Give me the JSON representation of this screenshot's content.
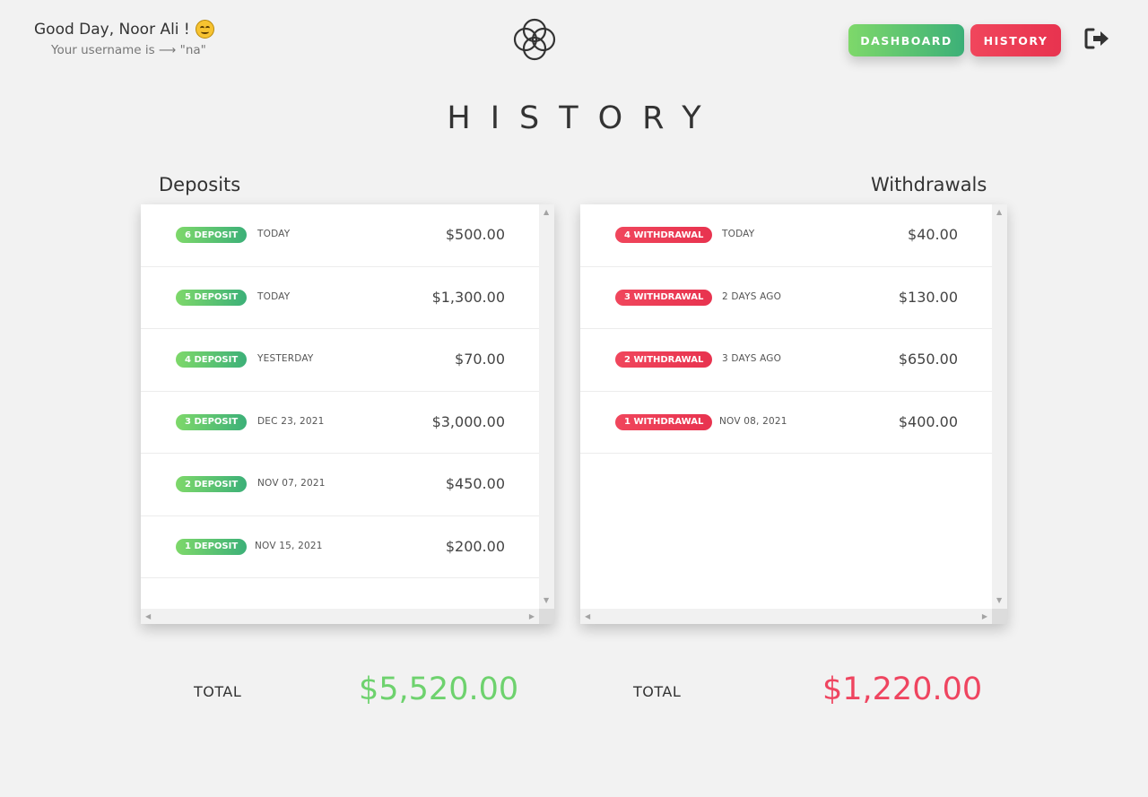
{
  "header": {
    "greeting": "Good Day, Noor Ali !",
    "username_line": "Your username is ⟶ \"na\"",
    "emoji": "smiling-face",
    "nav": {
      "dashboard_label": "DASHBOARD",
      "history_label": "HISTORY"
    },
    "logo": "interlocking-rings-logo",
    "logout_icon": "sign-out-icon"
  },
  "page_title": "HISTORY",
  "deposits": {
    "title": "Deposits",
    "items": [
      {
        "badge": "6 DEPOSIT",
        "date": "TODAY",
        "amount": "$500.00"
      },
      {
        "badge": "5 DEPOSIT",
        "date": "TODAY",
        "amount": "$1,300.00"
      },
      {
        "badge": "4 DEPOSIT",
        "date": "YESTERDAY",
        "amount": "$70.00"
      },
      {
        "badge": "3 DEPOSIT",
        "date": "DEC 23, 2021",
        "amount": "$3,000.00"
      },
      {
        "badge": "2 DEPOSIT",
        "date": "NOV 07, 2021",
        "amount": "$450.00"
      },
      {
        "badge": "1 DEPOSIT",
        "date": "NOV 15, 2021",
        "amount": "$200.00"
      }
    ],
    "total_label": "TOTAL",
    "total_value": "$5,520.00"
  },
  "withdrawals": {
    "title": "Withdrawals",
    "items": [
      {
        "badge": "4 WITHDRAWAL",
        "date": "TODAY",
        "amount": "$40.00"
      },
      {
        "badge": "3 WITHDRAWAL",
        "date": "2 DAYS AGO",
        "amount": "$130.00"
      },
      {
        "badge": "2 WITHDRAWAL",
        "date": "3 DAYS AGO",
        "amount": "$650.00"
      },
      {
        "badge": "1 WITHDRAWAL",
        "date": "NOV 08, 2021",
        "amount": "$400.00"
      }
    ],
    "total_label": "TOTAL",
    "total_value": "$1,220.00"
  },
  "colors": {
    "deposit_accent": "#6ed26e",
    "withdrawal_accent": "#ef4560",
    "background": "#f2f2f2"
  }
}
